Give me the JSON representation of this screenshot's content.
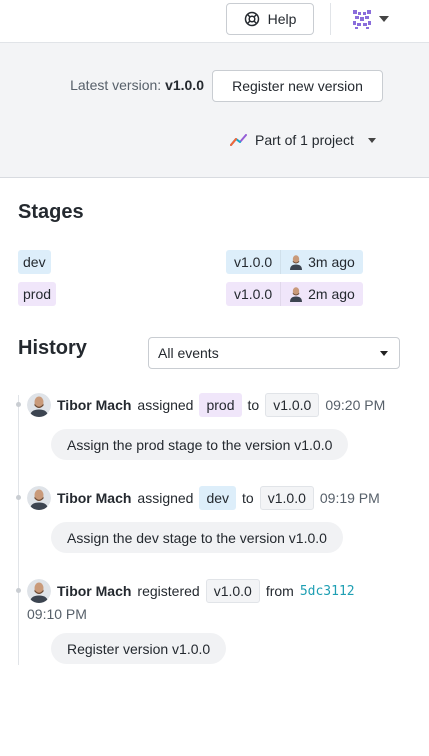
{
  "topbar": {
    "help_label": "Help"
  },
  "header": {
    "latest_label": "Latest version:",
    "latest_value": "v1.0.0",
    "register_label": "Register new version",
    "project_label": "Part of 1 project"
  },
  "stages": {
    "title": "Stages",
    "rows": [
      {
        "name": "dev",
        "version": "v1.0.0",
        "ago": "3m ago"
      },
      {
        "name": "prod",
        "version": "v1.0.0",
        "ago": "2m ago"
      }
    ]
  },
  "history": {
    "title": "History",
    "filter_value": "All events",
    "events": [
      {
        "user": "Tibor Mach",
        "action": "assigned",
        "stage": "prod",
        "to": "to",
        "version": "v1.0.0",
        "time": "09:20 PM",
        "message": "Assign the prod stage to the version v1.0.0"
      },
      {
        "user": "Tibor Mach",
        "action": "assigned",
        "stage": "dev",
        "to": "to",
        "version": "v1.0.0",
        "time": "09:19 PM",
        "message": "Assign the dev stage to the version v1.0.0"
      },
      {
        "user": "Tibor Mach",
        "action": "registered",
        "version": "v1.0.0",
        "from": "from",
        "sha": "5dc3112",
        "time": "09:10 PM",
        "message": "Register version v1.0.0"
      }
    ]
  },
  "colors": {
    "dev_pill": "#ddeefa",
    "prod_pill": "#f0e6fa",
    "sha_link": "#1f9fb3",
    "header_bg": "#f3f4f6"
  }
}
